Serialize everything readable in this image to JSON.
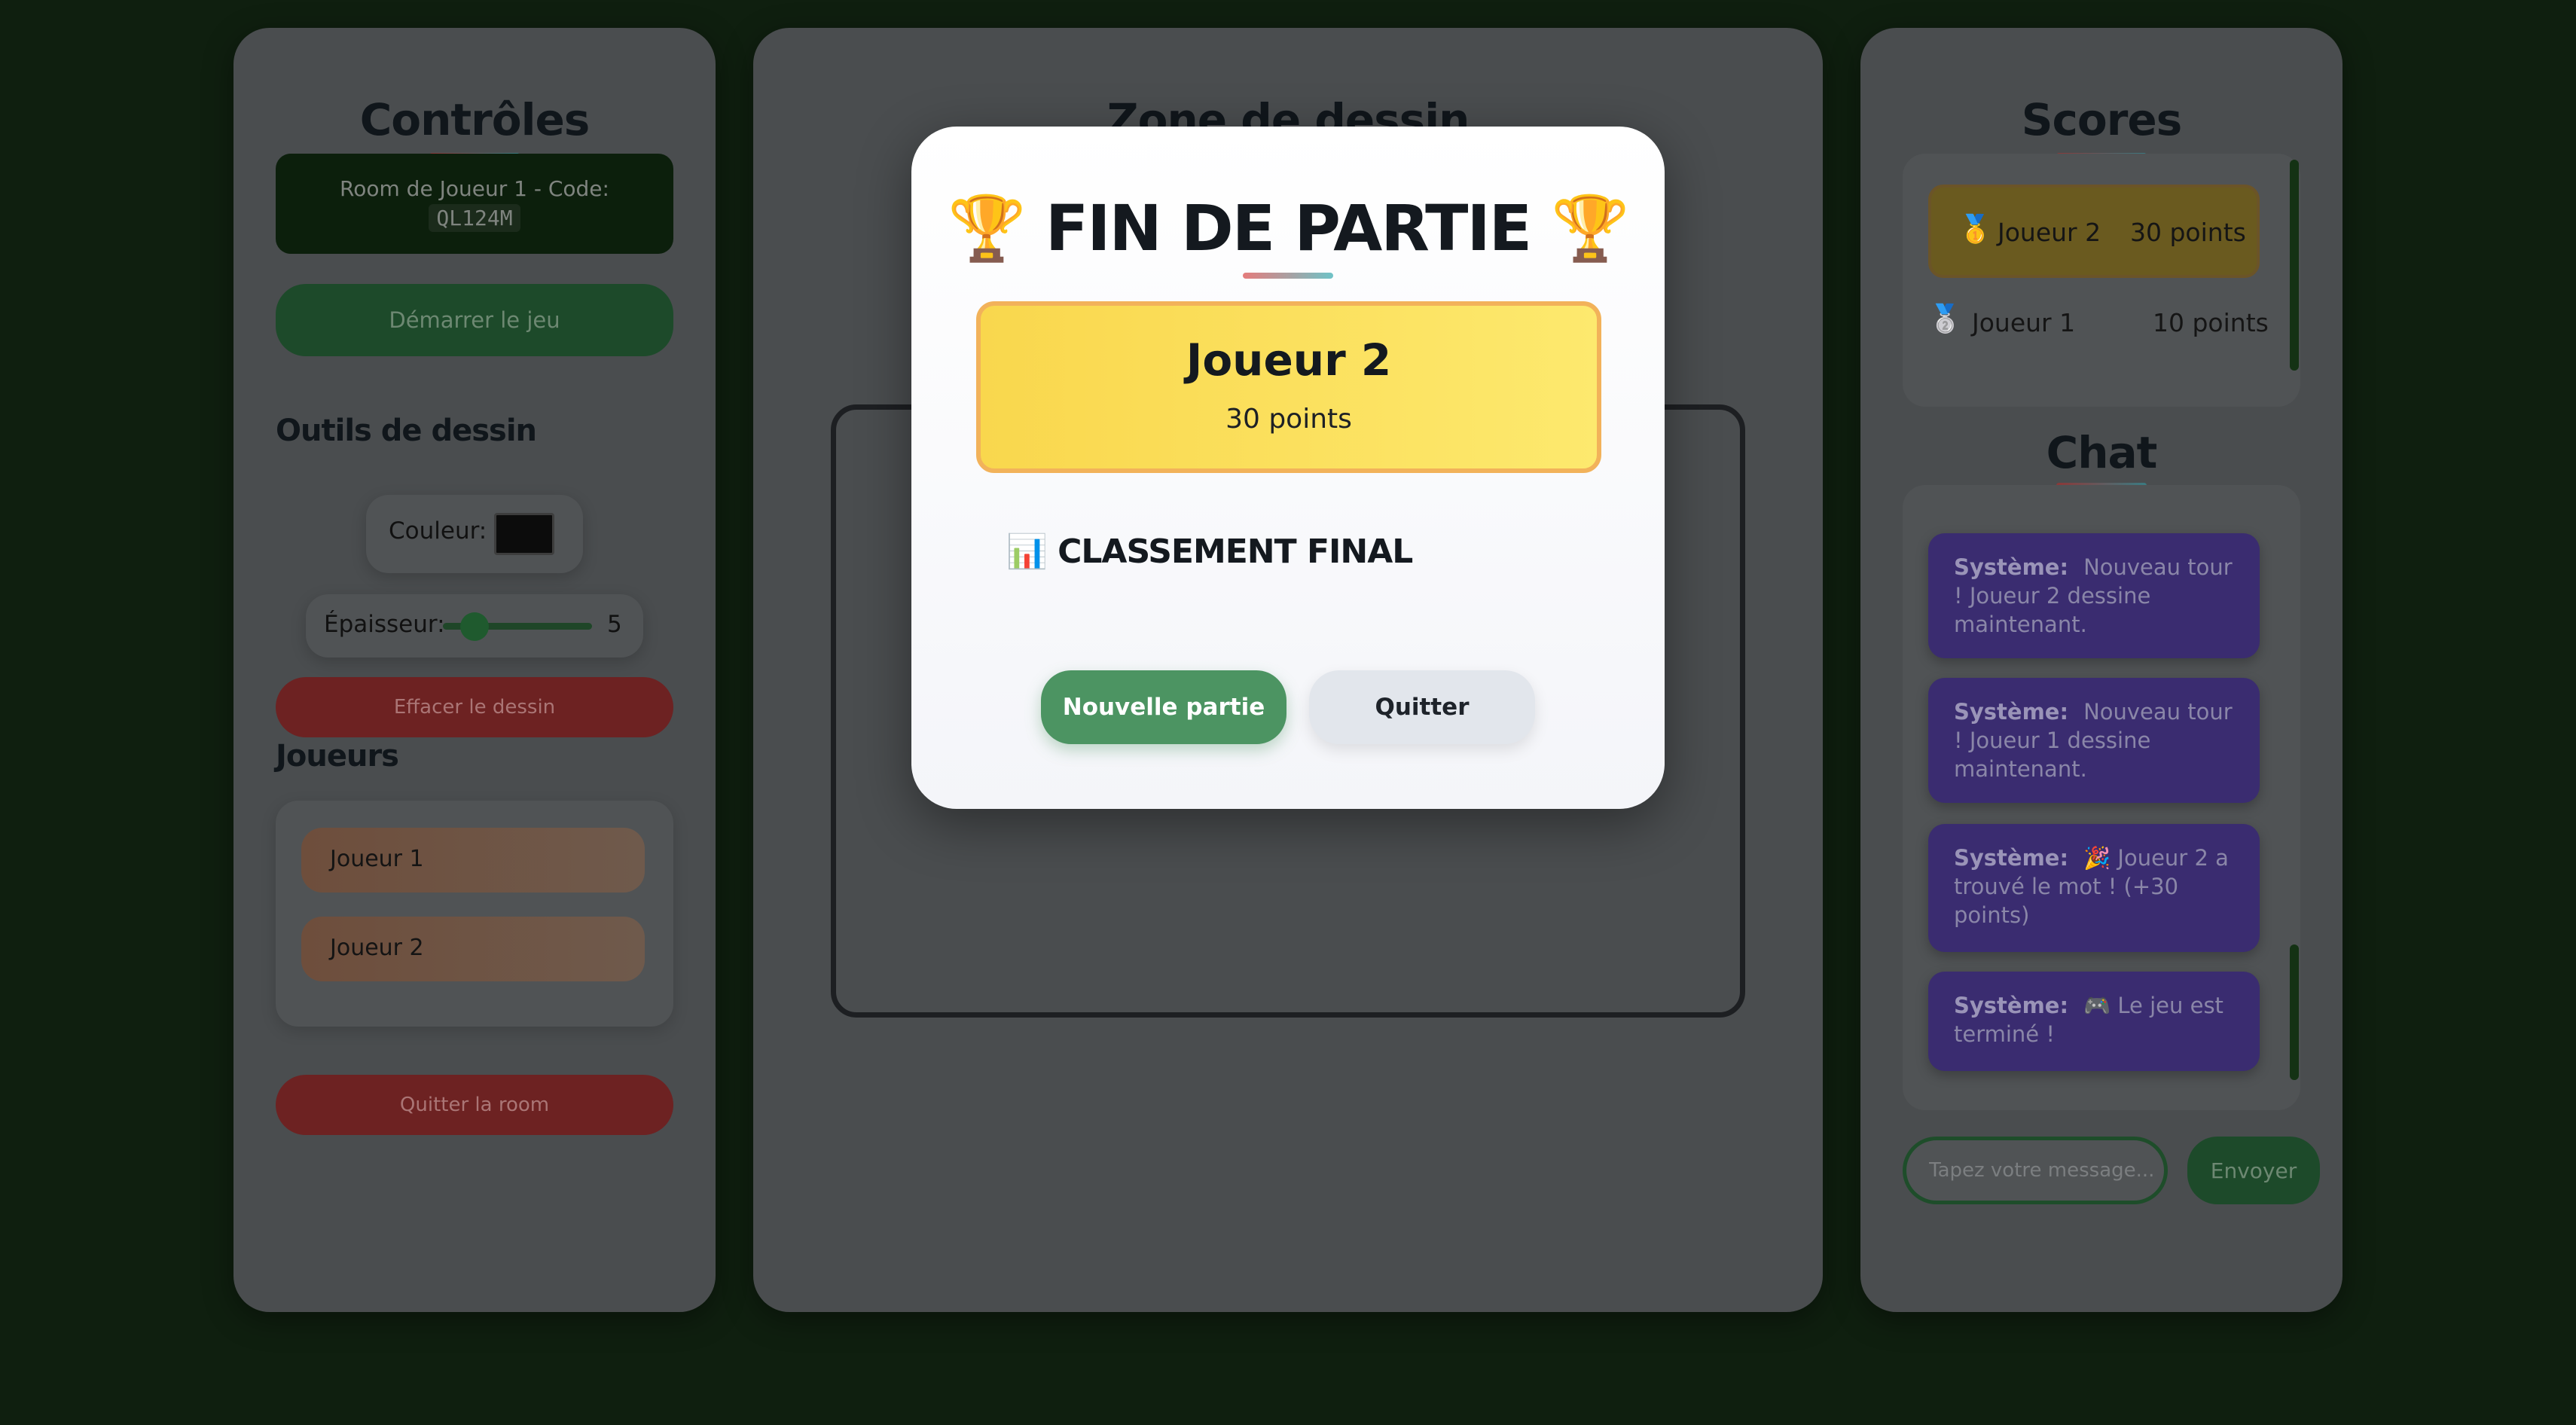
{
  "left_panel": {
    "title": "Contrôles",
    "room_label": "Room de Joueur 1 - Code:",
    "room_code": "QL124M",
    "start_button": "Démarrer le jeu",
    "tools_heading": "Outils de dessin",
    "color_label": "Couleur:",
    "color_value": "#0c0c0c",
    "thickness_label": "Épaisseur:",
    "thickness_value": "5",
    "clear_button": "Effacer le dessin",
    "players_heading": "Joueurs",
    "players": [
      "Joueur 1",
      "Joueur 2"
    ],
    "leave_room_button": "Quitter la room"
  },
  "center_panel": {
    "title": "Zone de dessin"
  },
  "right_panel": {
    "scores_title": "Scores",
    "scores": [
      {
        "medal": "🥇",
        "name": "Joueur 2",
        "points": "30 points"
      },
      {
        "medal": "🥈",
        "name": "Joueur 1",
        "points": "10 points"
      }
    ],
    "chat_title": "Chat",
    "messages": [
      {
        "sender": "Système:",
        "text": "Nouveau tour ! Joueur 2 dessine maintenant."
      },
      {
        "sender": "Système:",
        "text": "Nouveau tour ! Joueur 1 dessine maintenant."
      },
      {
        "sender": "Système:",
        "text": "🎉 Joueur 2 a trouvé le mot ! (+30 points)"
      },
      {
        "sender": "Système:",
        "text": "🎮 Le jeu est terminé !"
      }
    ],
    "chat_placeholder": "Tapez votre message...",
    "send_button": "Envoyer"
  },
  "modal": {
    "title": "🏆 FIN DE PARTIE 🏆",
    "winner_name": "Joueur 2",
    "winner_points": "30 points",
    "final_ranking_heading": "📊 CLASSEMENT FINAL",
    "new_game_button": "Nouvelle partie",
    "quit_button": "Quitter"
  },
  "colors": {
    "page_background": "#0f1f0f",
    "accent_green": "#4c9462",
    "danger_red": "#6d2222",
    "winner_gold": "#f9d74d",
    "chat_message": "#3a2c70"
  }
}
